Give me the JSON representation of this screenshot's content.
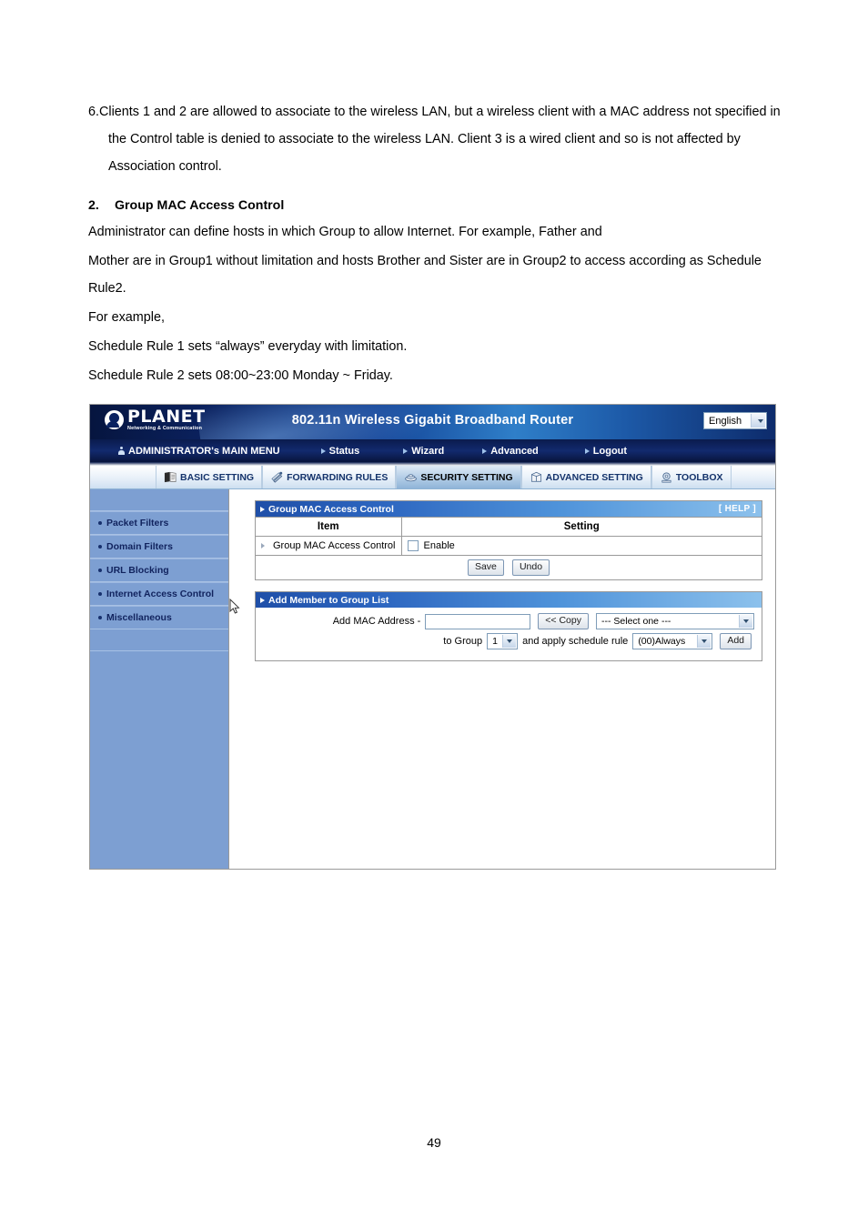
{
  "document": {
    "paragraphs": [
      "6.Clients 1 and 2 are allowed to associate to the wireless LAN, but a wireless client with a MAC address not specified in the Control table is denied to associate to the wireless LAN. Client 3 is a wired client and so is not affected by Association control."
    ],
    "heading": {
      "number": "2.",
      "text": "Group MAC Access Control"
    },
    "body": [
      "Administrator can define hosts in which Group to allow Internet. For example, Father and",
      "Mother are in Group1 without limitation and hosts Brother and Sister are in Group2 to access according as Schedule Rule2.",
      "For example,",
      "Schedule Rule 1 sets “always” everyday with limitation.",
      "Schedule Rule 2 sets 08:00~23:00 Monday ~ Friday."
    ],
    "page_number": "49"
  },
  "router_ui": {
    "brand": {
      "name": "PLANET",
      "tagline": "Networking & Communication"
    },
    "title": "802.11n Wireless Gigabit Broadband Router",
    "language": {
      "selected": "English"
    },
    "main_menu": [
      {
        "label": "ADMINISTRATOR's MAIN MENU",
        "icon": "person-icon"
      },
      {
        "label": "Status",
        "icon": "arrow-right-icon"
      },
      {
        "label": "Wizard",
        "icon": "arrow-right-icon"
      },
      {
        "label": "Advanced",
        "icon": "arrow-right-icon"
      },
      {
        "label": "Logout",
        "icon": "arrow-right-icon"
      }
    ],
    "tabs": [
      {
        "label": "BASIC SETTING",
        "icon": "book-icon",
        "active": false
      },
      {
        "label": "FORWARDING RULES",
        "icon": "arrows-icon",
        "active": false
      },
      {
        "label": "SECURITY SETTING",
        "icon": "shield-icon",
        "active": true
      },
      {
        "label": "ADVANCED SETTING",
        "icon": "box-icon",
        "active": false
      },
      {
        "label": "TOOLBOX",
        "icon": "tools-icon",
        "active": false
      }
    ],
    "sidebar": [
      {
        "label": "Packet Filters"
      },
      {
        "label": "Domain Filters"
      },
      {
        "label": "URL Blocking"
      },
      {
        "label": "Internet Access Control"
      },
      {
        "label": "Miscellaneous"
      }
    ],
    "panel1": {
      "title": "Group MAC Access Control",
      "help": "[ HELP ]",
      "columns": {
        "item": "Item",
        "setting": "Setting"
      },
      "row": {
        "item": "Group MAC Access Control",
        "setting_label": "Enable",
        "checked": false
      },
      "buttons": {
        "save": "Save",
        "undo": "Undo"
      }
    },
    "panel2": {
      "title": "Add Member to Group List",
      "mac_label": "Add MAC Address -",
      "mac_value": "",
      "copy_button": "<< Copy",
      "select_one": "--- Select one ---",
      "to_group_label": "to Group",
      "group_value": "1",
      "schedule_label": "and apply schedule rule",
      "schedule_value": "(00)Always",
      "add_button": "Add"
    }
  },
  "colors": {
    "header_dark": "#0a2260",
    "header_light": "#2f7fc9",
    "sidebar": "#7d9fd2",
    "panel_head_start": "#1f4fa8",
    "panel_head_end": "#8cc1ec",
    "sidebar_text": "#11235e"
  }
}
